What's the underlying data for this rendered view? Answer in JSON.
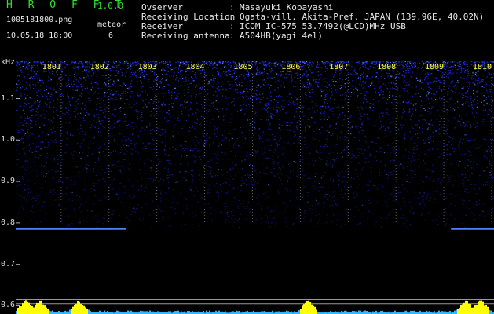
{
  "header": {
    "app_title": "H R O F F T",
    "app_version": "1.0.0",
    "file_name": "1005181800.png",
    "meteor_label": "meteor",
    "date_time": "10.05.18 18:00",
    "meteor_count": "6"
  },
  "info": [
    {
      "label": "Ovserver",
      "value": "Masayuki Kobayashi"
    },
    {
      "label": "Receiving Location",
      "value": "Ogata-vill. Akita-Pref. JAPAN (139.96E, 40.02N)"
    },
    {
      "label": "Receiver",
      "value": "ICOM IC-575 53.7492(@LCD)MHz USB"
    },
    {
      "label": "Receiving antenna",
      "value": "A504HB(yagi 4el)"
    }
  ],
  "info_separator": ":",
  "chart_data": {
    "type": "heatmap",
    "ylabel": "kHz",
    "x_ticks": [
      "1801",
      "1802",
      "1803",
      "1804",
      "1805",
      "1806",
      "1807",
      "1808",
      "1809",
      "1810"
    ],
    "y_ticks": [
      {
        "label": "1.1",
        "value": 1.1
      },
      {
        "label": "1.0",
        "value": 1.0
      },
      {
        "label": "0.9",
        "value": 0.9
      },
      {
        "label": "0.8",
        "value": 0.8
      },
      {
        "label": "0.7",
        "value": 0.7
      },
      {
        "label": "0.6",
        "value": 0.6
      }
    ],
    "ylim": [
      0.58,
      1.19
    ],
    "noise_band": {
      "from": 0.79,
      "to": 1.19
    },
    "carrier_line": {
      "freq": 0.785,
      "segments": [
        [
          0.0,
          0.23
        ],
        [
          0.91,
          1.0
        ]
      ]
    },
    "meteor_echoes": [
      0.02,
      0.05,
      0.13,
      0.61,
      0.94,
      0.97
    ],
    "reference_lines": [
      0.615,
      0.605
    ],
    "colors": {
      "noise": "#2030ff",
      "noise_bright": "#60a0ff",
      "carrier": "#5080ff",
      "ref_line": "#9a9a9a",
      "grid_dot": "#b0b0b0",
      "meter": "#30b8ff",
      "meter_peak": "#ffff00",
      "tick_text": "#ffff40"
    }
  }
}
